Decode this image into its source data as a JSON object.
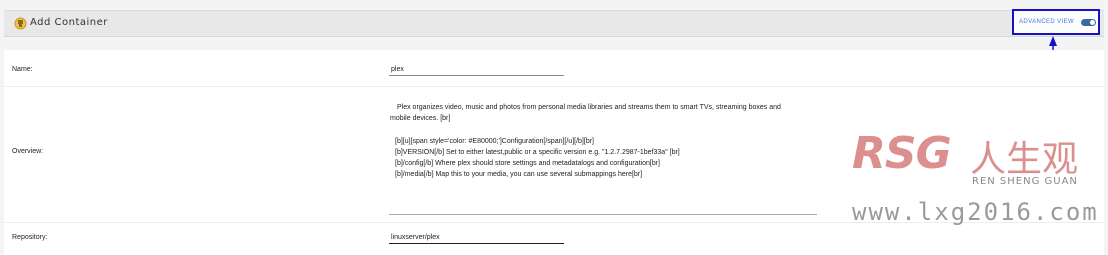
{
  "header": {
    "title": "Add Container",
    "advanced_view_label": "ADVANCED VIEW",
    "advanced_view_on": true
  },
  "form": {
    "name_label": "Name:",
    "name_value": "plex",
    "overview_label": "Overview:",
    "overview_lines": [
      "Plex organizes video, music and photos from personal media libraries and streams them to smart TVs, streaming boxes and",
      "mobile devices. [br]",
      "[b][u][span style='color: #E80000;']Configuration[/span][/u][/b][br]",
      "[b]VERSION[/b] Set to either latest,public or a specific version e.g. \"1.2.7.2987-1bef33a\" [br]",
      "[b]/config[/b] Where plex should store settings and metadatalogs and configuration[br]",
      "[b]/media[/b] Map this to your media, you can use several submappings here[br]"
    ],
    "repository_label": "Repository:",
    "repository_value": "linuxserver/plex"
  },
  "watermark": {
    "brand": "RSG",
    "cn": "人生观",
    "sub": "REN SHENG GUAN",
    "url": "www.lxg2016.com"
  },
  "colors": {
    "annotation": "#1a10c8",
    "toggle": "#3a67a8",
    "watermark": "#d06a6a"
  }
}
